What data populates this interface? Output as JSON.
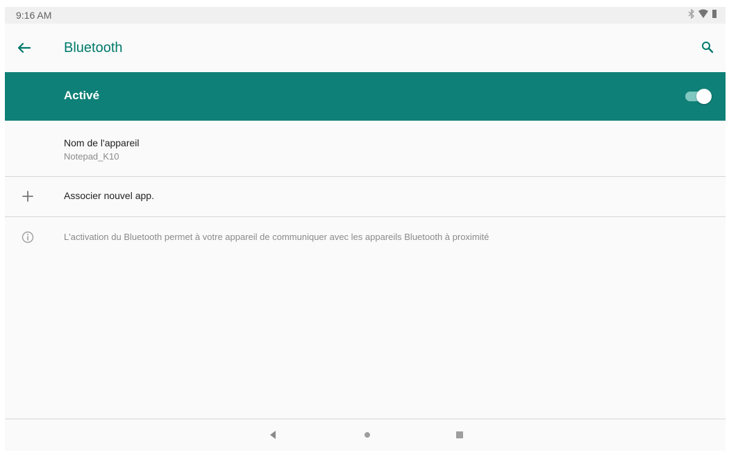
{
  "status_bar": {
    "time": "9:16 AM",
    "icons": [
      "bluetooth-icon",
      "wifi-icon",
      "battery-icon"
    ]
  },
  "app_bar": {
    "title": "Bluetooth",
    "back_icon": "arrow-back-icon",
    "search_icon": "search-icon"
  },
  "master_switch": {
    "label": "Activé",
    "state": "on"
  },
  "device_name": {
    "title": "Nom de l'appareil",
    "value": "Notepad_K10"
  },
  "pair_new": {
    "icon": "plus-icon",
    "label": "Associer nouvel app."
  },
  "info": {
    "icon": "info-icon",
    "text": "L'activation du Bluetooth permet à votre appareil de communiquer avec les appareils Bluetooth à proximité"
  },
  "nav_bar": {
    "back_icon": "nav-back-icon",
    "home_icon": "nav-home-icon",
    "recents_icon": "nav-recents-icon"
  },
  "colors": {
    "accent": "#00796b",
    "master_bg": "#0f8077"
  }
}
